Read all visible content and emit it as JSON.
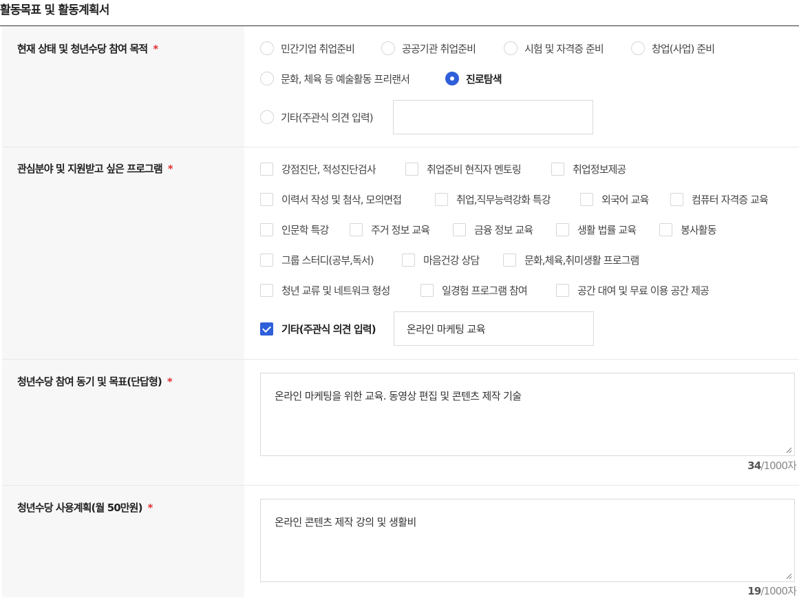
{
  "section": {
    "title": "활동목표 및 활동계획서"
  },
  "purpose": {
    "label": "현재 상태 및 청년수당 참여 목적",
    "required_mark": "*",
    "options": [
      {
        "label": "민간기업 취업준비",
        "selected": false
      },
      {
        "label": "공공기관 취업준비",
        "selected": false
      },
      {
        "label": "시험 및 자격증 준비",
        "selected": false
      },
      {
        "label": "창업(사업) 준비",
        "selected": false
      },
      {
        "label": "문화, 체육 등 예술활동 프리랜서",
        "selected": false
      },
      {
        "label": "진로탐색",
        "selected": true
      },
      {
        "label": "기타(주관식 의견 입력)",
        "selected": false
      }
    ],
    "other_value": ""
  },
  "programs": {
    "label": "관심분야 및 지원받고 싶은 프로그램",
    "required_mark": "*",
    "options": [
      {
        "label": "강점진단, 적성진단검사",
        "checked": false
      },
      {
        "label": "취업준비 현직자 멘토링",
        "checked": false
      },
      {
        "label": "취업정보제공",
        "checked": false
      },
      {
        "label": "이력서 작성 및 첨삭, 모의면접",
        "checked": false
      },
      {
        "label": "취업,직무능력강화 특강",
        "checked": false
      },
      {
        "label": "외국어 교육",
        "checked": false
      },
      {
        "label": "컴퓨터 자격증 교육",
        "checked": false
      },
      {
        "label": "인문학 특강",
        "checked": false
      },
      {
        "label": "주거 정보 교육",
        "checked": false
      },
      {
        "label": "금융 정보 교육",
        "checked": false
      },
      {
        "label": "생활 법률 교육",
        "checked": false
      },
      {
        "label": "봉사활동",
        "checked": false
      },
      {
        "label": "그룹 스터디(공부,독서)",
        "checked": false
      },
      {
        "label": "마음건강 상담",
        "checked": false
      },
      {
        "label": "문화,체육,취미생활 프로그램",
        "checked": false
      },
      {
        "label": "청년 교류 및 네트워크 형성",
        "checked": false
      },
      {
        "label": "일경험 프로그램 참여",
        "checked": false
      },
      {
        "label": "공간 대여 및 무료 이용 공간 제공",
        "checked": false
      },
      {
        "label": "기타(주관식 의견 입력)",
        "checked": true
      }
    ],
    "other_value": "온라인 마케팅 교육"
  },
  "motivation": {
    "label": "청년수당 참여 동기 및 목표(단답형)",
    "required_mark": "*",
    "value": "온라인 마케팅을 위한 교육. 동영상 편집 및 콘텐츠 제작 기술",
    "count": "34",
    "limit": "/1000자"
  },
  "usage": {
    "label": "청년수당 사용계획(월 50만원)",
    "required_mark": "*",
    "value": "온라인 콘텐츠 제작 강의 및 생활비",
    "count": "19",
    "limit": "/1000자"
  }
}
